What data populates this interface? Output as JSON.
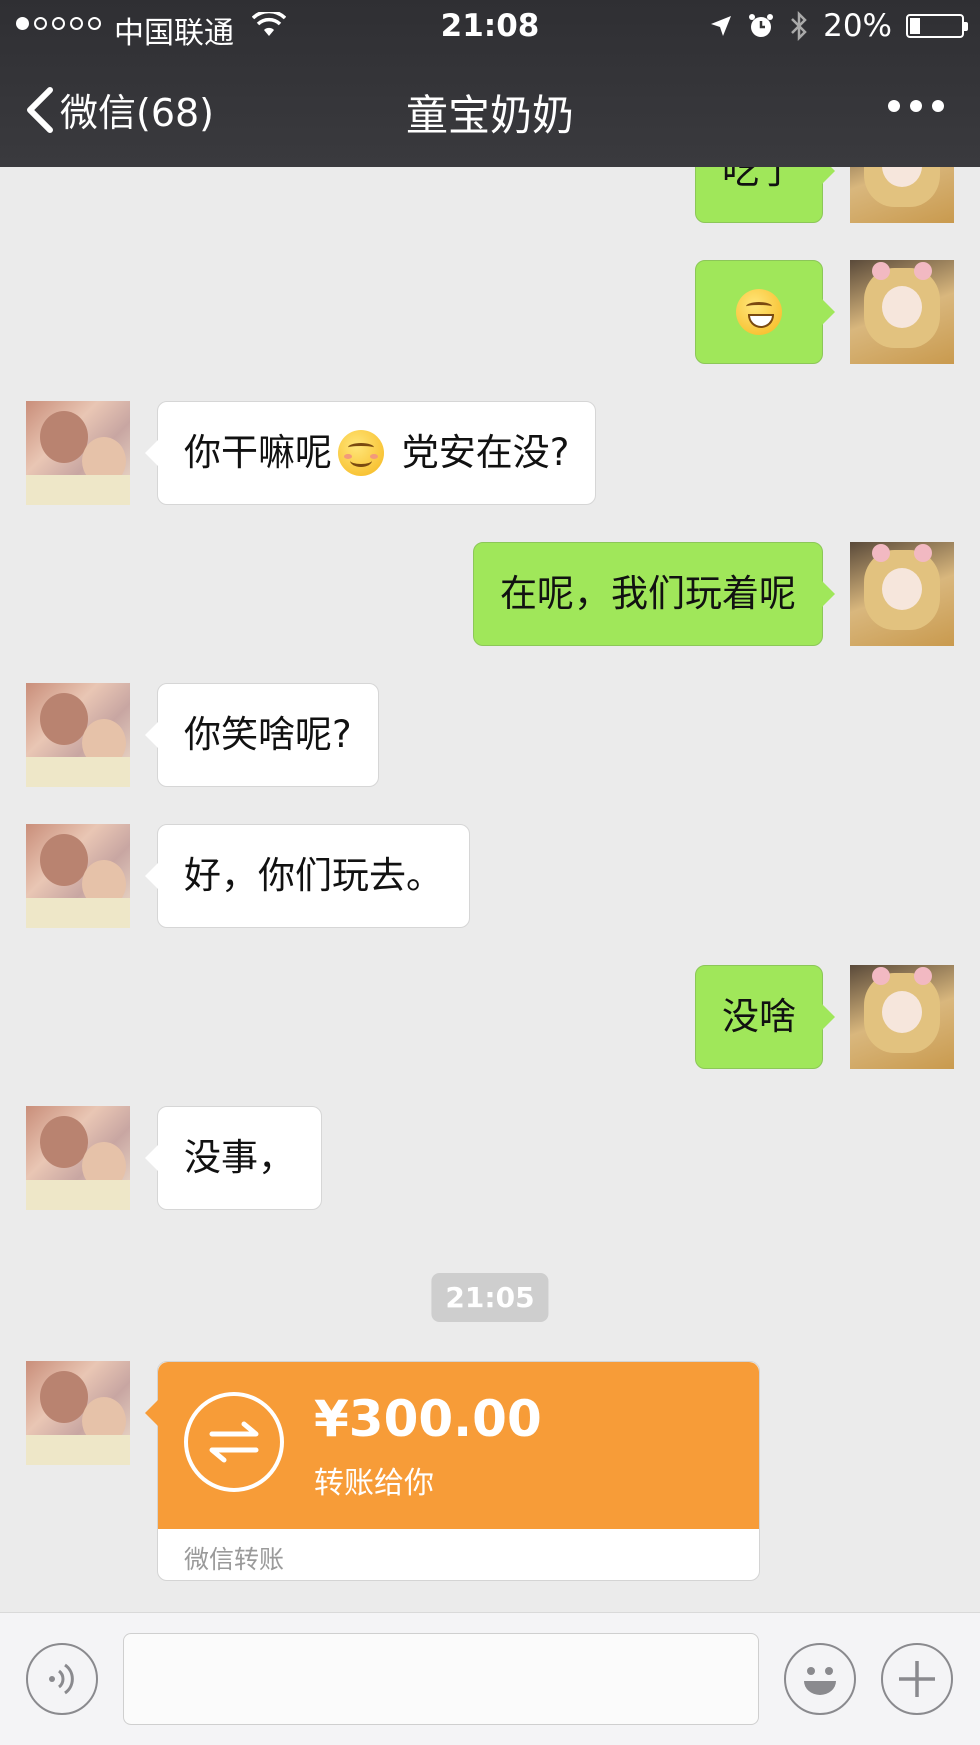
{
  "status_bar": {
    "carrier": "中国联通",
    "time": "21:08",
    "battery_text": "20%",
    "battery_level": 0.2,
    "signal_bars_filled": 1,
    "signal_bars_total": 5
  },
  "nav": {
    "back_label": "微信(68)",
    "title": "童宝奶奶"
  },
  "messages": [
    {
      "side": "right",
      "text": "吃了"
    },
    {
      "side": "right",
      "emoji": "grin-emoji"
    },
    {
      "side": "left",
      "text_before": "你干嘛呢",
      "emoji": "smile-emoji",
      "text_after": " 党安在没?"
    },
    {
      "side": "right",
      "text": "在呢，我们玩着呢"
    },
    {
      "side": "left",
      "text": "你笑啥呢?"
    },
    {
      "side": "left",
      "text": "好，你们玩去。"
    },
    {
      "side": "right",
      "text": "没啥"
    },
    {
      "side": "left",
      "text": "没事，"
    }
  ],
  "timestamp": "21:05",
  "transfer": {
    "amount": "¥300.00",
    "description": "转账给你",
    "footer": "微信转账"
  },
  "colors": {
    "nav_bg": "#333337",
    "bubble_mine": "#a0e75a",
    "bubble_theirs": "#ffffff",
    "chat_bg": "#ebebeb",
    "transfer_orange": "#f79c38"
  },
  "icons": {
    "back": "chevron-left-icon",
    "more": "more-dots-icon",
    "voice": "voice-icon",
    "emoji": "emoji-icon",
    "add": "plus-icon"
  }
}
